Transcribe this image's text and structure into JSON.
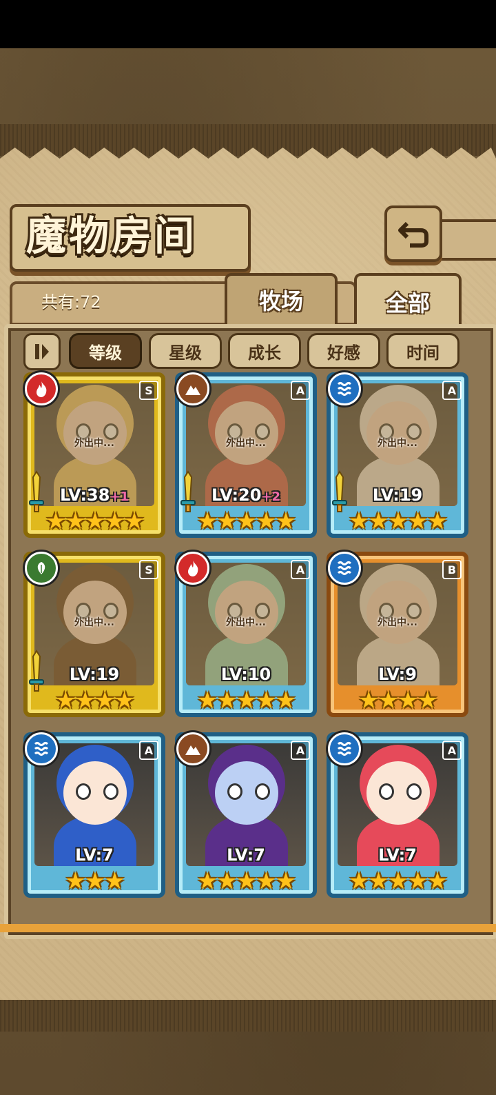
{
  "title": "魔物房间",
  "count_label": "共有:72",
  "tabs": [
    {
      "label": "牧场",
      "active": false
    },
    {
      "label": "全部",
      "active": true
    }
  ],
  "sort_buttons": [
    {
      "label": "等级",
      "active": true
    },
    {
      "label": "星级",
      "active": false
    },
    {
      "label": "成长",
      "active": false
    },
    {
      "label": "好感",
      "active": false
    },
    {
      "label": "时间",
      "active": false
    }
  ],
  "cards": [
    {
      "frame": "gold",
      "element": "fire",
      "rank": "S",
      "status": "外出中...",
      "lv": "LV:38",
      "plus": "+1",
      "stars": "★★★★★",
      "weapon": true,
      "hair": "#e9c36a",
      "skin": "#f6d7c6"
    },
    {
      "frame": "blue",
      "element": "earth",
      "rank": "A",
      "status": "外出中...",
      "lv": "LV:20",
      "plus": "+2",
      "stars": "★★★★★",
      "weapon": true,
      "hair": "#c9574f",
      "skin": "#f6d7c6"
    },
    {
      "frame": "blue",
      "element": "water",
      "rank": "A",
      "status": "外出中...",
      "lv": "LV:19",
      "plus": "",
      "stars": "★★★★★",
      "weapon": true,
      "hair": "#e8e2dc",
      "skin": "#f6d7c6"
    },
    {
      "frame": "gold",
      "element": "wind",
      "rank": "S",
      "status": "外出中...",
      "lv": "LV:19",
      "plus": "",
      "stars": "★★★★",
      "weapon": true,
      "hair": "#5a3a22",
      "skin": "#f6d7c6"
    },
    {
      "frame": "blue",
      "element": "fire",
      "rank": "A",
      "status": "外出中...",
      "lv": "LV:10",
      "plus": "",
      "stars": "★★★★★",
      "weapon": false,
      "hair": "#8fd4bc",
      "skin": "#f6d7c6"
    },
    {
      "frame": "orange",
      "element": "water",
      "rank": "B",
      "status": "外出中...",
      "lv": "LV:9",
      "plus": "",
      "stars": "★★★★",
      "weapon": false,
      "hair": "#e8e0d6",
      "skin": "#f6d7c6"
    },
    {
      "frame": "blue",
      "element": "water",
      "rank": "A",
      "status": "",
      "lv": "LV:7",
      "plus": "",
      "stars": "★★★",
      "weapon": false,
      "hair": "#2f5fc8",
      "skin": "#fbe6d6"
    },
    {
      "frame": "blue",
      "element": "earth",
      "rank": "A",
      "status": "",
      "lv": "LV:7",
      "plus": "",
      "stars": "★★★★★",
      "weapon": false,
      "hair": "#5a2f8a",
      "skin": "#bcd0f4"
    },
    {
      "frame": "blue",
      "element": "water",
      "rank": "A",
      "status": "",
      "lv": "LV:7",
      "plus": "",
      "stars": "★★★★★",
      "weapon": false,
      "hair": "#e64a5a",
      "skin": "#fbe6d6"
    }
  ],
  "colors": {
    "fire": "#d32a2a",
    "earth": "#8a4a22",
    "water": "#1f6fc0",
    "wind": "#3a7a30"
  },
  "icons": {
    "back": "return-arrow-icon",
    "sort_toggle": "sort-order-icon"
  }
}
